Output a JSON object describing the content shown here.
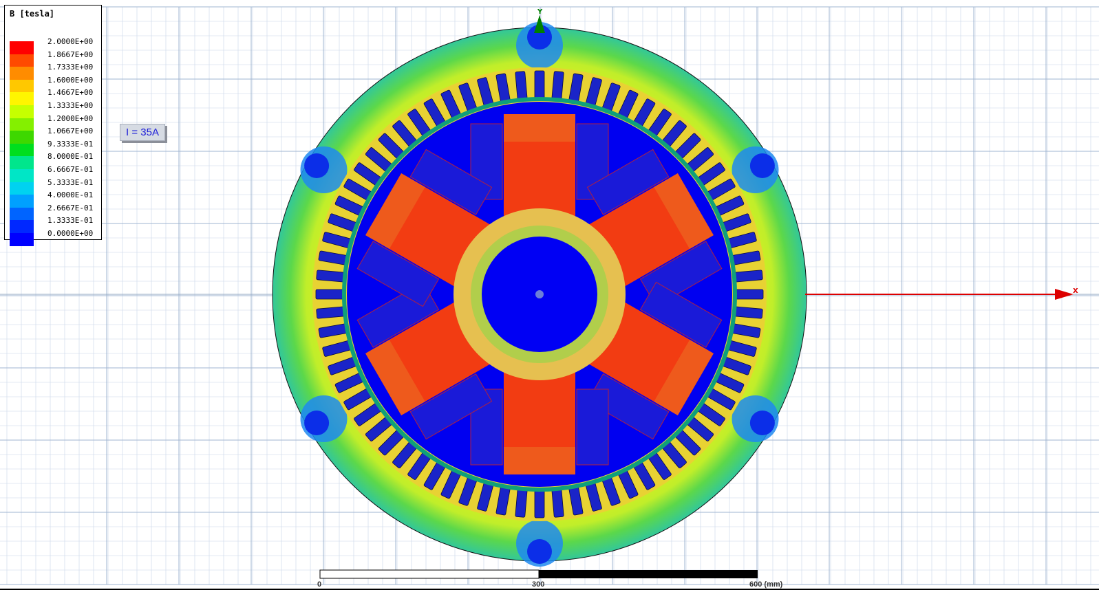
{
  "legend": {
    "title": "B [tesla]",
    "entries": [
      {
        "label": "2.0000E+00",
        "color": "#ff0000"
      },
      {
        "label": "1.8667E+00",
        "color": "#ff4a00"
      },
      {
        "label": "1.7333E+00",
        "color": "#ff8c00"
      },
      {
        "label": "1.6000E+00",
        "color": "#ffc800"
      },
      {
        "label": "1.4667E+00",
        "color": "#fff500"
      },
      {
        "label": "1.3333E+00",
        "color": "#c6ff00"
      },
      {
        "label": "1.2000E+00",
        "color": "#84f000"
      },
      {
        "label": "1.0667E+00",
        "color": "#3ed800"
      },
      {
        "label": "9.3333E-01",
        "color": "#00de1e"
      },
      {
        "label": "8.0000E-01",
        "color": "#00e68c"
      },
      {
        "label": "6.6667E-01",
        "color": "#00e6c6"
      },
      {
        "label": "5.3333E-01",
        "color": "#00d2f0"
      },
      {
        "label": "4.0000E-01",
        "color": "#00a0ff"
      },
      {
        "label": "2.6667E-01",
        "color": "#0064ff"
      },
      {
        "label": "1.3333E-01",
        "color": "#0028ff"
      },
      {
        "label": "0.0000E+00",
        "color": "#0000ff"
      }
    ]
  },
  "annotation": {
    "text": "I = 35A"
  },
  "axes": {
    "x_label": "X",
    "y_label": "Y",
    "x_color": "#dd0000",
    "y_color": "#008000"
  },
  "scale_bar": {
    "labels": [
      "0",
      "300",
      "600 (mm)"
    ]
  },
  "colors": {
    "grid": "#c8d6e8",
    "yoke_outer": "#a6e03a",
    "yoke_mid": "#2cd650",
    "pole_core": "#f23c12",
    "pole_tip": "#0000f0",
    "rotor_yoke": "#e6c050",
    "shaft": "#0000f4"
  }
}
